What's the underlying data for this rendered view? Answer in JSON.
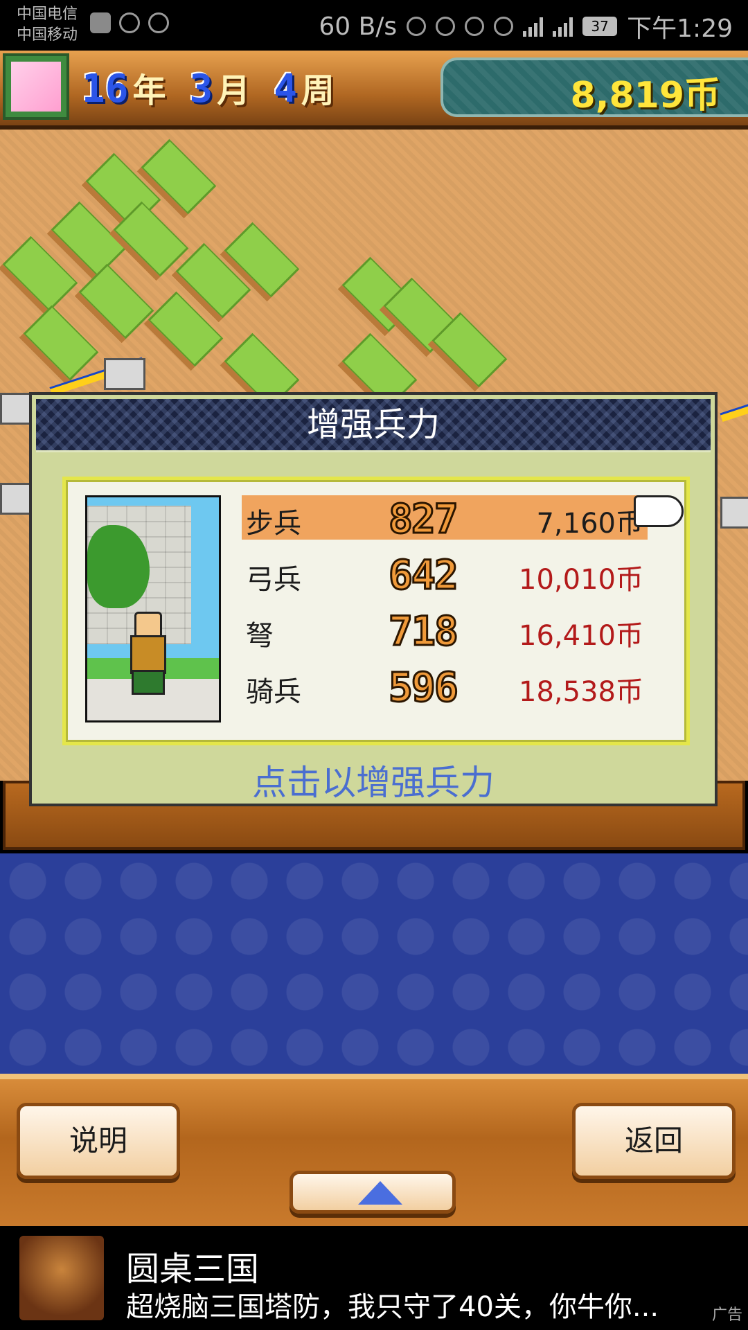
{
  "status_bar": {
    "carrier1": "中国电信",
    "carrier2": "中国移动",
    "net_speed": "60 B/s",
    "battery": "37",
    "time": "下午1:29"
  },
  "header": {
    "year": "16",
    "year_unit": "年",
    "month": "3",
    "month_unit": "月",
    "week": "4",
    "week_unit": "周",
    "money": "8,819币"
  },
  "dialog": {
    "title": "增强兵力",
    "troops": [
      {
        "name": "步兵",
        "count": "827",
        "price": "7,160币",
        "selected": true
      },
      {
        "name": "弓兵",
        "count": "642",
        "price": "10,010币",
        "selected": false
      },
      {
        "name": "弩",
        "count": "718",
        "price": "16,410币",
        "selected": false
      },
      {
        "name": "骑兵",
        "count": "596",
        "price": "18,538币",
        "selected": false
      }
    ],
    "hint": "点击以增强兵力"
  },
  "buttons": {
    "help": "说明",
    "back": "返回"
  },
  "ad": {
    "title": "圆桌三国",
    "text": "超烧脑三国塔防，我只守了40关，你牛你...",
    "tag": "广告"
  },
  "colors": {
    "selected_row": "#f0a45e",
    "price_red": "#b31a1a",
    "hint_blue": "#4a6ed0",
    "money_yellow": "#ffe53b"
  }
}
